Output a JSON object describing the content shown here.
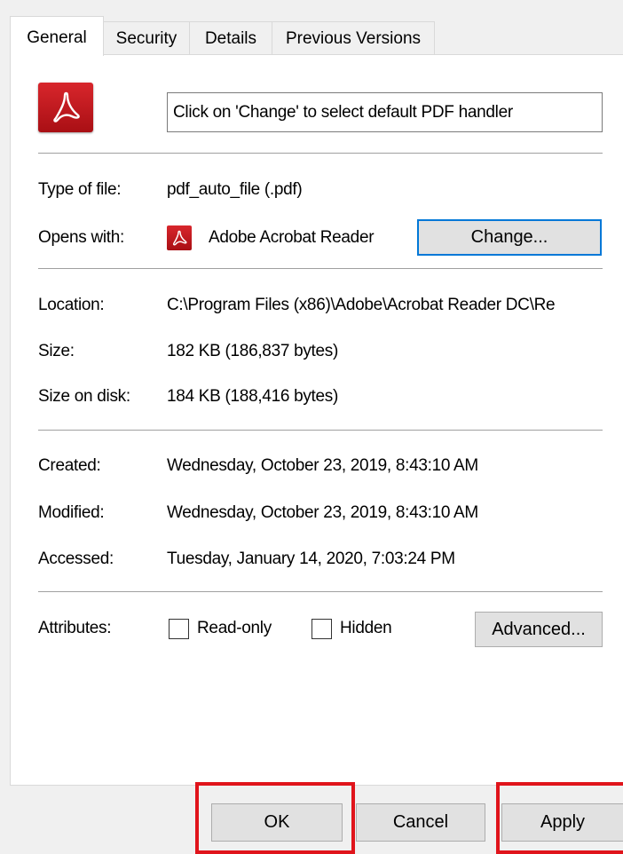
{
  "tabs": [
    {
      "label": "General",
      "active": true
    },
    {
      "label": "Security",
      "active": false
    },
    {
      "label": "Details",
      "active": false
    },
    {
      "label": "Previous Versions",
      "active": false
    }
  ],
  "description_box": "Click on 'Change' to select default PDF handler",
  "fields": {
    "type_label": "Type of file:",
    "type_value": "pdf_auto_file (.pdf)",
    "opens_label": "Opens with:",
    "opens_value": "Adobe Acrobat Reader",
    "change_button": "Change...",
    "location_label": "Location:",
    "location_value": "C:\\Program Files (x86)\\Adobe\\Acrobat Reader DC\\Re",
    "size_label": "Size:",
    "size_value": "182 KB (186,837 bytes)",
    "size_disk_label": "Size on disk:",
    "size_disk_value": "184 KB (188,416 bytes)",
    "created_label": "Created:",
    "created_value": "Wednesday, October 23, 2019, 8:43:10 AM",
    "modified_label": "Modified:",
    "modified_value": "Wednesday, October 23, 2019, 8:43:10 AM",
    "accessed_label": "Accessed:",
    "accessed_value": "Tuesday, January 14, 2020, 7:03:24 PM",
    "attributes_label": "Attributes:",
    "readonly_label": "Read-only",
    "readonly_checked": false,
    "hidden_label": "Hidden",
    "hidden_checked": false,
    "advanced_button": "Advanced..."
  },
  "footer": {
    "ok": "OK",
    "cancel": "Cancel",
    "apply": "Apply"
  },
  "colors": {
    "highlight_box": "#e0141b",
    "focus_border": "#0078d7",
    "pdf_icon": "#c8151b"
  },
  "icons": {
    "file_icon": "acrobat-pdf-icon",
    "app_icon": "acrobat-pdf-icon"
  }
}
